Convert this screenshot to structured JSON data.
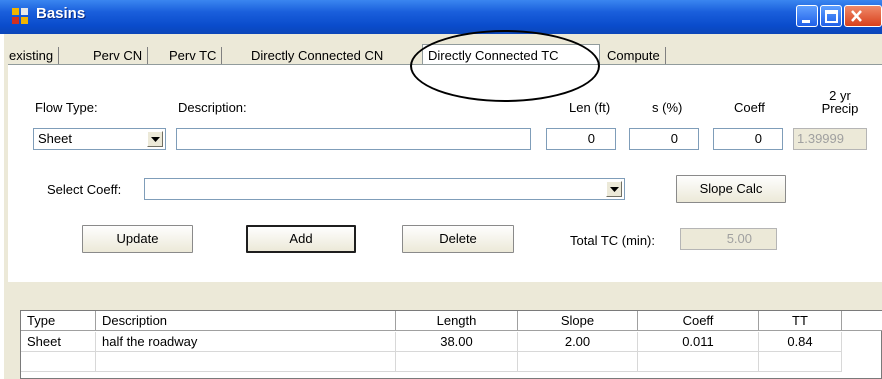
{
  "window": {
    "title": "Basins",
    "accent": "#0a4ccc"
  },
  "tabs": [
    {
      "label": "existing",
      "active": false
    },
    {
      "label": "Perv CN",
      "active": false
    },
    {
      "label": "Perv TC",
      "active": false
    },
    {
      "label": "Directly Connected CN",
      "active": false
    },
    {
      "label": "Directly Connected TC",
      "active": true
    },
    {
      "label": "Compute",
      "active": false
    }
  ],
  "form": {
    "flow_type_label": "Flow Type:",
    "flow_type_value": "Sheet",
    "description_label": "Description:",
    "description_value": "",
    "len_label": "Len (ft)",
    "len_value": "0",
    "s_label": "s (%)",
    "s_value": "0",
    "coeff_label": "Coeff",
    "coeff_value": "0",
    "precip_label_line1": "2 yr",
    "precip_label_line2": "Precip",
    "precip_value": "1.39999",
    "select_coeff_label": "Select Coeff:",
    "select_coeff_value": "",
    "slope_calc_label": "Slope Calc",
    "update_label": "Update",
    "add_label": "Add",
    "delete_label": "Delete",
    "total_tc_label": "Total TC (min):",
    "total_tc_value": "5.00"
  },
  "grid": {
    "columns": [
      "Type",
      "Description",
      "Length",
      "Slope",
      "Coeff",
      "TT"
    ],
    "rows": [
      [
        "Sheet",
        "half the roadway",
        "38.00",
        "2.00",
        "0.011",
        "0.84"
      ]
    ]
  }
}
